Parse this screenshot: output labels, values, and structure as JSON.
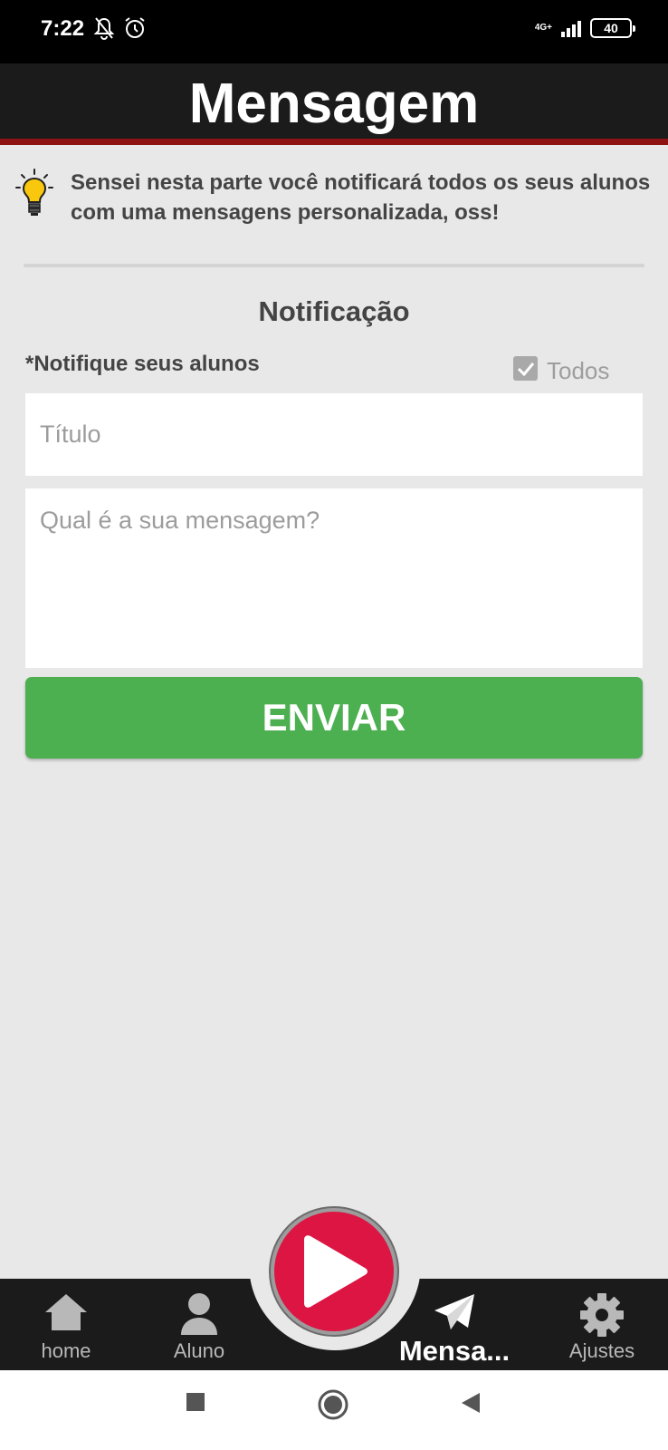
{
  "status_bar": {
    "time": "7:22",
    "network": "4G+",
    "battery": "40"
  },
  "header": {
    "title": "Mensagem"
  },
  "tip": {
    "text": "Sensei nesta parte você notificará todos os seus alunos com uma mensagens personalizada, oss!"
  },
  "form": {
    "section_title": "Notificação",
    "notify_label": "*Notifique seus alunos",
    "todos_label": "Todos",
    "todos_checked": true,
    "title_placeholder": "Título",
    "title_value": "",
    "message_placeholder": "Qual é a sua mensagem?",
    "message_value": "",
    "send_label": "ENVIAR"
  },
  "bottom_nav": {
    "items": [
      {
        "label": "home",
        "icon": "home-icon"
      },
      {
        "label": "Aluno",
        "icon": "user-icon"
      },
      {
        "label": "Mensa...",
        "icon": "paper-plane-icon",
        "active": true
      },
      {
        "label": "Ajustes",
        "icon": "gear-icon"
      }
    ],
    "center_icon": "play-icon"
  },
  "colors": {
    "header_bg": "#1b1b1b",
    "header_accent": "#8e1414",
    "send_button": "#4caf50",
    "play_button": "#dc1543",
    "background": "#e8e8e8"
  }
}
